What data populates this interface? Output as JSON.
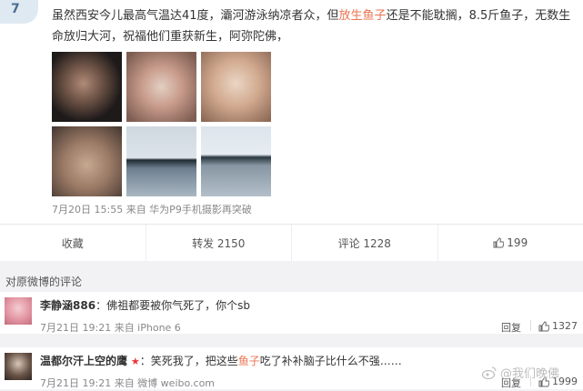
{
  "post": {
    "text_before": "虽然西安今儿最高气温达41度，灞河游泳纳凉者众，但",
    "highlight": "放生鱼子",
    "text_after": "还是不能耽搁，8.5斤鱼子，无数生命放归大河，祝福他们重获新生，阿弥陀佛，",
    "meta": "7月20日 15:55 来自 华为P9手机摄影再突破"
  },
  "actions": {
    "collect": "收藏",
    "repost": "转发 2150",
    "comment": "评论 1228",
    "like": "199"
  },
  "comments_section": {
    "title": "对原微博的评论"
  },
  "comments": [
    {
      "name": "李静涵886",
      "sep": "：",
      "text_before": "佛祖都要被你气死了，你个sb",
      "highlight": "",
      "text_after": "",
      "meta": "7月21日 19:21 来自 iPhone 6",
      "reply": "回复",
      "likes": "1327"
    },
    {
      "name": "温都尔汗上空的鹰",
      "badge": "★",
      "sep": "：",
      "text_before": "笑死我了，把这些",
      "highlight": "鱼子",
      "text_after": "吃了补补脑子比什么不强……",
      "meta": "7月21日 19:21 来自 微博 weibo.com",
      "reply": "回复",
      "likes": "1999"
    }
  ],
  "watermark": "@我们晚佛",
  "colors": {
    "highlight": "#eb7350",
    "background": "#f2f2f5"
  },
  "icons": {
    "like": "thumbs-up-icon",
    "weibo": "weibo-logo-icon"
  }
}
